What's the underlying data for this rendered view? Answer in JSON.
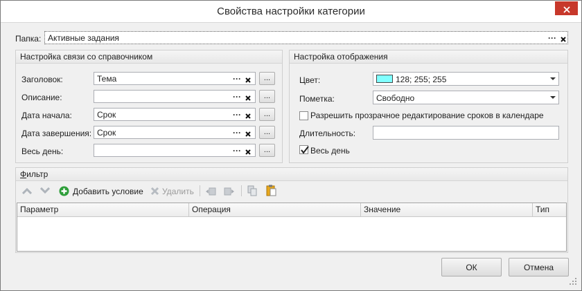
{
  "window": {
    "title": "Свойства настройки категории"
  },
  "folder": {
    "label": "Папка:",
    "value": "Активные задания",
    "dots": "···"
  },
  "link_group": {
    "title": "Настройка связи со справочником",
    "rows": [
      {
        "label": "Заголовок:",
        "value": "Тема"
      },
      {
        "label": "Описание:",
        "value": ""
      },
      {
        "label": "Дата начала:",
        "value": "Срок"
      },
      {
        "label": "Дата завершения:",
        "value": "Срок"
      },
      {
        "label": "Весь день:",
        "value": ""
      }
    ],
    "browse": "..."
  },
  "display_group": {
    "title": "Настройка отображения",
    "color_label": "Цвет:",
    "color_value": "128; 255; 255",
    "color_hex": "#80ffff",
    "mark_label": "Пометка:",
    "mark_value": "Свободно",
    "transparent_edit_label": "Разрешить прозрачное редактирование сроков в календаре",
    "transparent_edit_checked": false,
    "duration_label": "Длительность:",
    "duration_value": "",
    "all_day_label": "Весь день",
    "all_day_checked": true
  },
  "filter": {
    "title_first": "Ф",
    "title_rest": "ильтр",
    "toolbar": {
      "add_label": "Добавить условие",
      "delete_label": "Удалить"
    },
    "columns": [
      "Параметр",
      "Операция",
      "Значение",
      "Тип"
    ]
  },
  "buttons": {
    "ok": "ОК",
    "cancel": "Отмена"
  },
  "colors": {
    "accent_add": "#2e9e3a",
    "close": "#c7382b",
    "paste": "#e8a81c"
  }
}
